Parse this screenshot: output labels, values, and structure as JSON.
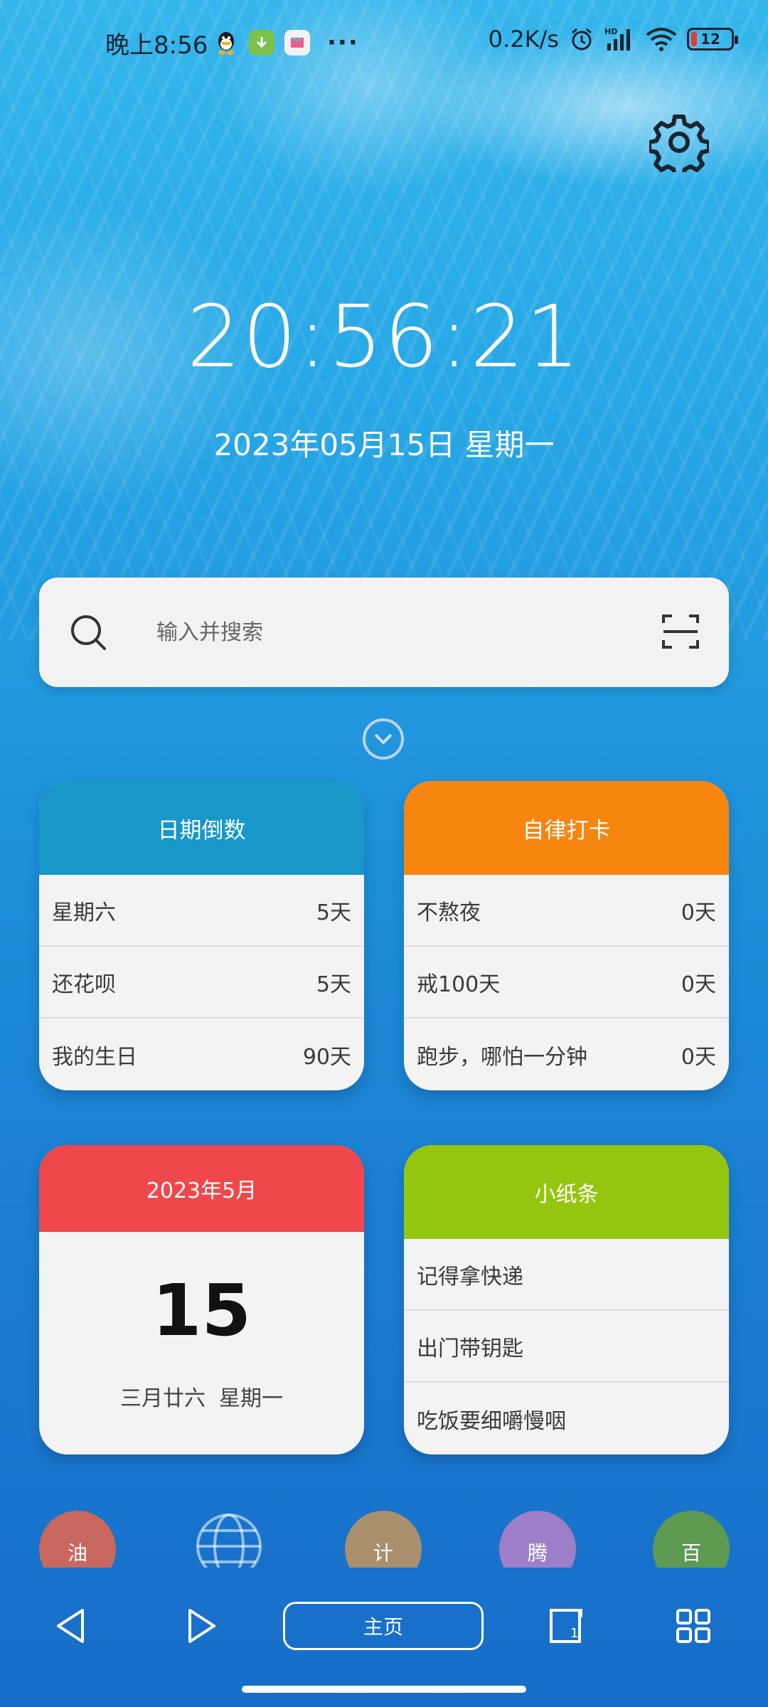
{
  "status_bar": {
    "time": "晚上8:56",
    "net_speed": "0.2K/s",
    "battery_level": "12",
    "more": "···"
  },
  "clock": {
    "time": "20:56:21",
    "date": "2023年05月15日 星期一"
  },
  "search": {
    "placeholder": "输入并搜索"
  },
  "countdown": {
    "title": "日期倒数",
    "items": [
      {
        "name": "星期六",
        "value": "5天"
      },
      {
        "name": "还花呗",
        "value": "5天"
      },
      {
        "name": "我的生日",
        "value": "90天"
      }
    ]
  },
  "checkin": {
    "title": "自律打卡",
    "items": [
      {
        "name": "不熬夜",
        "value": "0天"
      },
      {
        "name": "戒100天",
        "value": "0天"
      },
      {
        "name": "跑步，哪怕一分钟",
        "value": "0天"
      }
    ]
  },
  "calendar": {
    "month": "2023年5月",
    "day": "15",
    "lunar": "三月廿六  星期一"
  },
  "notes": {
    "title": "小纸条",
    "items": [
      "记得拿快递",
      "出门带钥匙",
      "吃饭要细嚼慢咽"
    ]
  },
  "dock": {
    "apps": [
      {
        "label": "油",
        "color": "#c9685e"
      },
      {
        "label": "",
        "color": "transparent"
      },
      {
        "label": "计",
        "color": "#a98f6c"
      },
      {
        "label": "腾",
        "color": "#9d7fc9"
      },
      {
        "label": "百",
        "color": "#5e9a52"
      }
    ]
  },
  "nav": {
    "home_label": "主页",
    "tab_count": "1"
  }
}
